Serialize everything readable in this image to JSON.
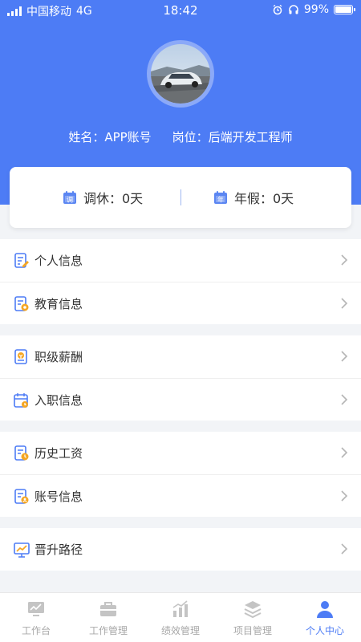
{
  "status_bar": {
    "carrier": "中国移动",
    "network": "4G",
    "time": "18:42",
    "battery": "99%",
    "battery_level": 0.99
  },
  "profile": {
    "name": "姓名：APP账号",
    "position": "岗位：后端开发工程师"
  },
  "leave": {
    "comp_time": {
      "icon": "calendar-icon",
      "icon_char": "调",
      "label": "调休：0天"
    },
    "annual": {
      "icon": "calendar-icon",
      "icon_char": "年",
      "label": "年假：0天"
    }
  },
  "menu_groups": [
    [
      {
        "label": "个人信息",
        "icon": "edit-doc-icon"
      },
      {
        "label": "教育信息",
        "icon": "education-icon"
      }
    ],
    [
      {
        "label": "职级薪酬",
        "icon": "salary-grade-icon"
      },
      {
        "label": "入职信息",
        "icon": "onboarding-icon"
      }
    ],
    [
      {
        "label": "历史工资",
        "icon": "history-salary-icon"
      },
      {
        "label": "账号信息",
        "icon": "account-icon"
      }
    ],
    [
      {
        "label": "晋升路径",
        "icon": "promotion-chart-icon"
      }
    ]
  ],
  "tabbar": [
    {
      "label": "工作台",
      "icon": "dashboard-icon",
      "active": false
    },
    {
      "label": "工作管理",
      "icon": "briefcase-icon",
      "active": false
    },
    {
      "label": "绩效管理",
      "icon": "bar-chart-icon",
      "active": false
    },
    {
      "label": "项目管理",
      "icon": "layers-icon",
      "active": false
    },
    {
      "label": "个人中心",
      "icon": "person-icon",
      "active": true
    }
  ],
  "colors": {
    "brand": "#4d7cf5",
    "inactive_tab": "#a8a8a8",
    "page_bg": "#f2f4f7"
  }
}
